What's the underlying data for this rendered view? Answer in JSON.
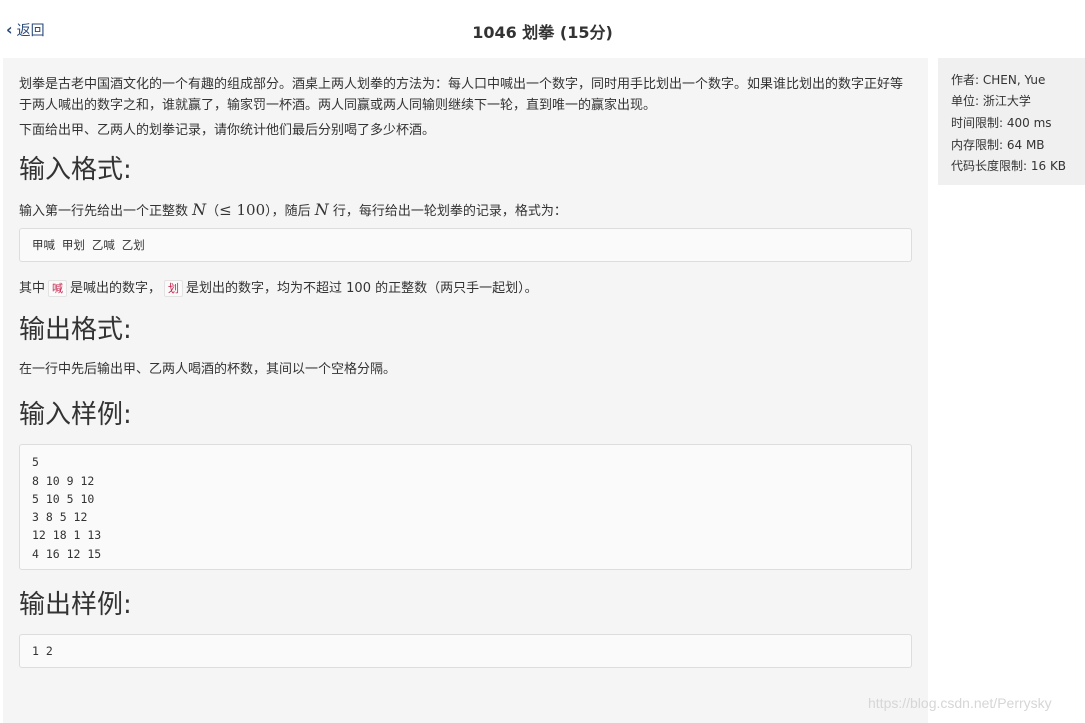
{
  "header": {
    "back_label": "返回",
    "title": "1046 划拳 (15分)"
  },
  "problem": {
    "intro": "划拳是古老中国酒文化的一个有趣的组成部分。酒桌上两人划拳的方法为：每人口中喊出一个数字，同时用手比划出一个数字。如果谁比划出的数字正好等于两人喊出的数字之和，谁就赢了，输家罚一杯酒。两人同赢或两人同输则继续下一轮，直到唯一的赢家出现。",
    "intro2": "下面给出甲、乙两人的划拳记录，请你统计他们最后分别喝了多少杯酒。",
    "input_heading": "输入格式:",
    "input_text_a": "输入第一行先给出一个正整数 ",
    "input_math_n": "N",
    "input_math_paren_open": "（",
    "input_math_leq": "≤ 100",
    "input_math_paren_close": "）",
    "input_text_b": "，随后 ",
    "input_math_n2": "N",
    "input_text_c": " 行，每行给出一轮划拳的记录，格式为：",
    "format_code": "甲喊 甲划 乙喊 乙划",
    "explain_a": "其中",
    "explain_code1": "喊",
    "explain_b": "是喊出的数字，",
    "explain_code2": "划",
    "explain_c": "是划出的数字，均为不超过 100 的正整数（两只手一起划）。",
    "output_heading": "输出格式:",
    "output_text": "在一行中先后输出甲、乙两人喝酒的杯数，其间以一个空格分隔。",
    "sample_in_heading": "输入样例:",
    "sample_in": "5\n8 10 9 12\n5 10 5 10\n3 8 5 12\n12 18 1 13\n4 16 12 15",
    "sample_out_heading": "输出样例:",
    "sample_out": "1 2"
  },
  "sidebar": {
    "author": "作者: CHEN, Yue",
    "unit": "单位: 浙江大学",
    "time_limit": "时间限制: 400 ms",
    "memory_limit": "内存限制: 64 MB",
    "code_limit": "代码长度限制: 16 KB"
  },
  "watermark": "https://blog.csdn.net/Perrysky",
  "colors": {
    "link": "#2b4a7a",
    "panel_bg": "#f5f5f5",
    "side_bg": "#f0f0f0",
    "code_text": "#c7254e"
  }
}
